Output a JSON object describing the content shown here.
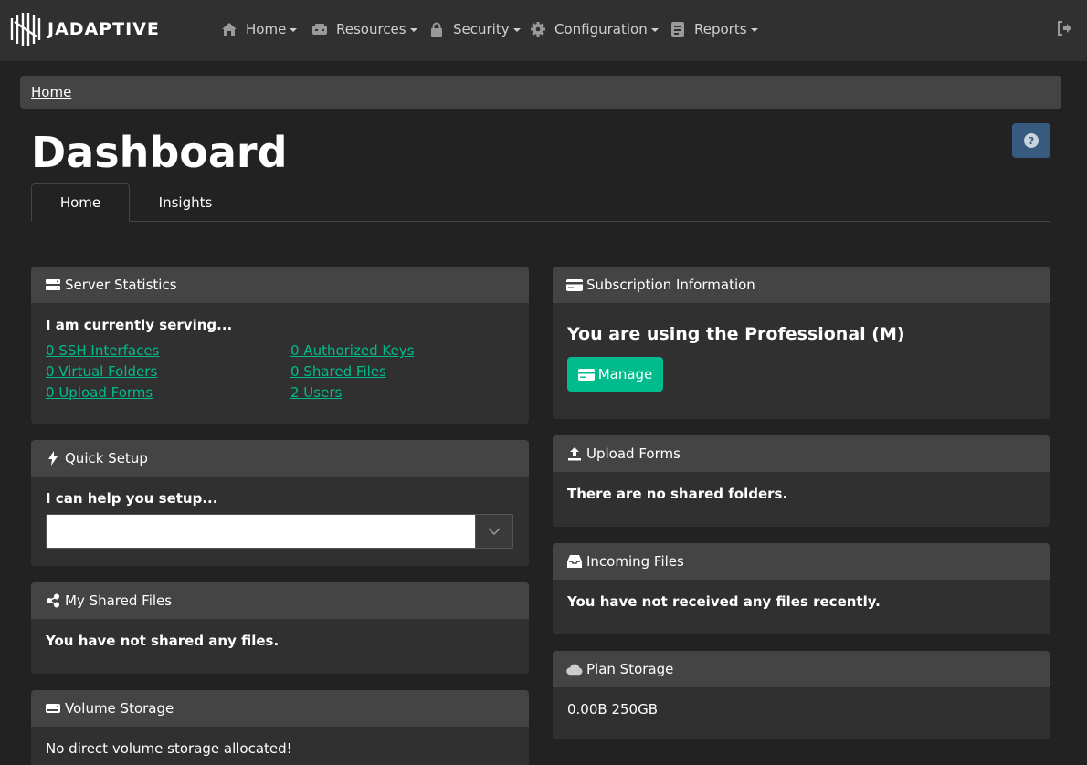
{
  "brand": {
    "name": "JADAPTIVE"
  },
  "nav": {
    "items": [
      {
        "label": "Home",
        "icon": "home-icon"
      },
      {
        "label": "Resources",
        "icon": "server-icon"
      },
      {
        "label": "Security",
        "icon": "lock-icon"
      },
      {
        "label": "Configuration",
        "icon": "gear-icon"
      },
      {
        "label": "Reports",
        "icon": "reports-icon"
      }
    ],
    "logout_icon": "logout-icon"
  },
  "breadcrumb": {
    "home": "Home"
  },
  "page": {
    "title": "Dashboard",
    "help_label": "?"
  },
  "tabs": [
    {
      "label": "Home"
    },
    {
      "label": "Insights"
    }
  ],
  "cards": {
    "server_statistics": {
      "title": "Server Statistics",
      "intro": "I am currently serving...",
      "links": [
        "0 SSH Interfaces",
        "0 Authorized Keys",
        "0 Virtual Folders",
        "0 Shared Files",
        "0 Upload Forms",
        "2 Users"
      ]
    },
    "quick_setup": {
      "title": "Quick Setup",
      "intro": "I can help you setup...",
      "select_value": ""
    },
    "my_shared_files": {
      "title": "My Shared Files",
      "message": "You have not shared any files."
    },
    "volume_storage": {
      "title": "Volume Storage",
      "message": "No direct volume storage allocated!"
    },
    "subscription": {
      "title": "Subscription Information",
      "prefix": "You are using the ",
      "plan": "Professional (M)",
      "manage_label": "Manage"
    },
    "upload_forms": {
      "title": "Upload Forms",
      "message": "There are no shared folders."
    },
    "incoming_files": {
      "title": "Incoming Files",
      "message": "You have not received any files recently."
    },
    "plan_storage": {
      "title": "Plan Storage",
      "value": "0.00B 250GB"
    }
  },
  "colors": {
    "accent": "#00bc8c",
    "help_button": "#375a7f",
    "card_header": "#444444",
    "card_body": "#303030",
    "background": "#222222"
  }
}
